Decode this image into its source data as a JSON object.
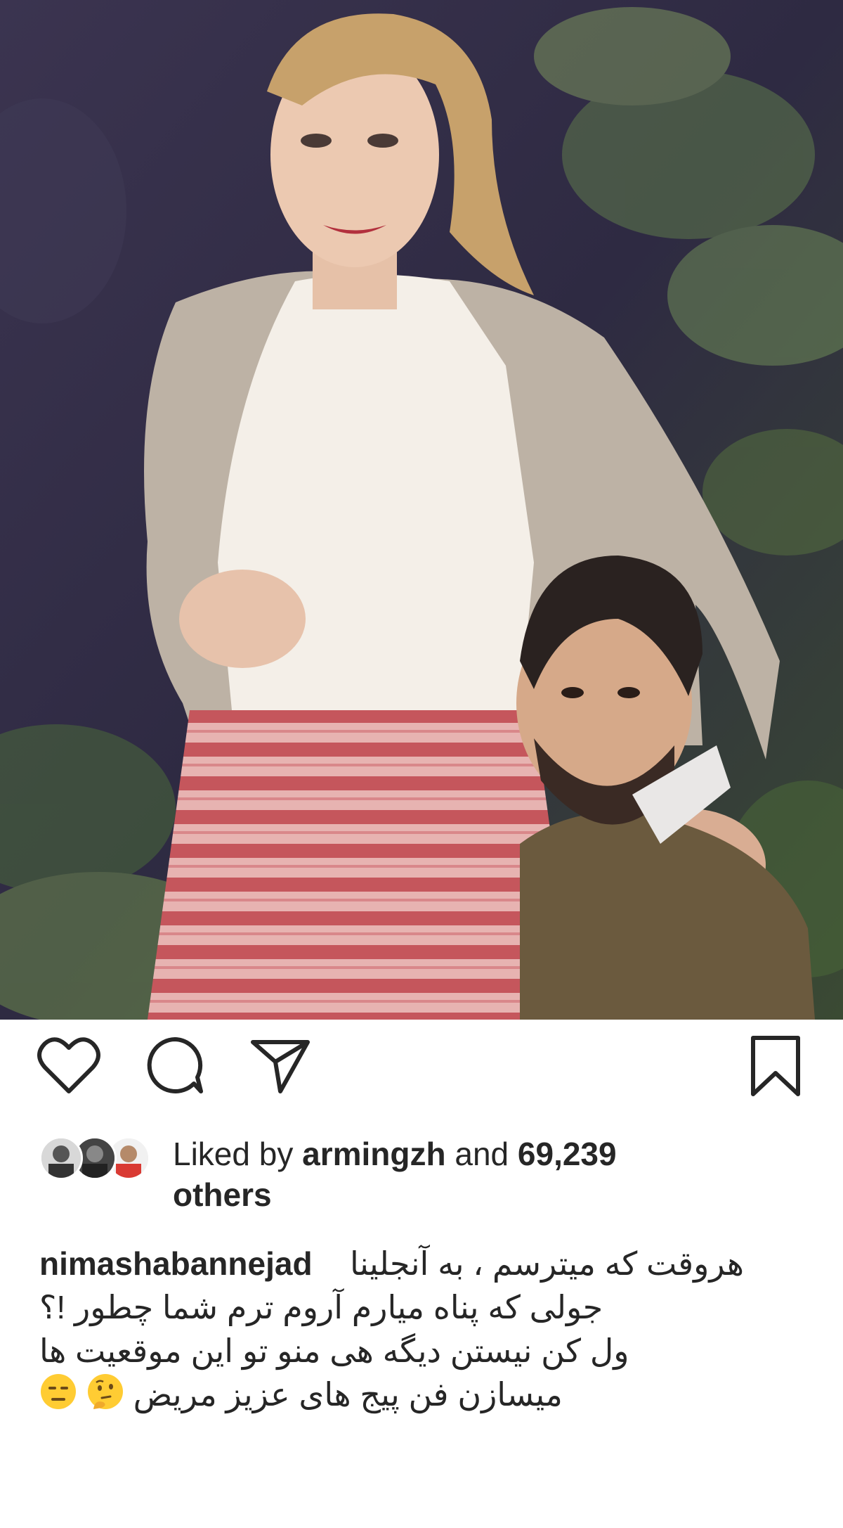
{
  "post": {
    "image_alt": "Photo of a woman in a cardigan and striped skirt with a man's head edited beside her",
    "actions": {
      "like_icon": "heart-outline-icon",
      "comment_icon": "comment-bubble-icon",
      "share_icon": "paper-plane-icon",
      "save_icon": "bookmark-outline-icon"
    },
    "likes": {
      "prefix": "Liked by",
      "user": "armingzh",
      "connector": "and",
      "count": "69,239",
      "suffix": "others"
    },
    "caption": {
      "username": "nimashabannejad",
      "line1": "هروقت که میترسم ، به آنجلینا",
      "line2": "جولی که پناه میارم آروم ترم شما چطور !؟",
      "line3": "ول کن نیستن دیگه هی منو تو این موقعیت ها",
      "line4": "میسازن  فن پیج های عزیز مریض",
      "emojis": [
        "thinking-face-emoji",
        "expressionless-face-emoji"
      ]
    }
  }
}
